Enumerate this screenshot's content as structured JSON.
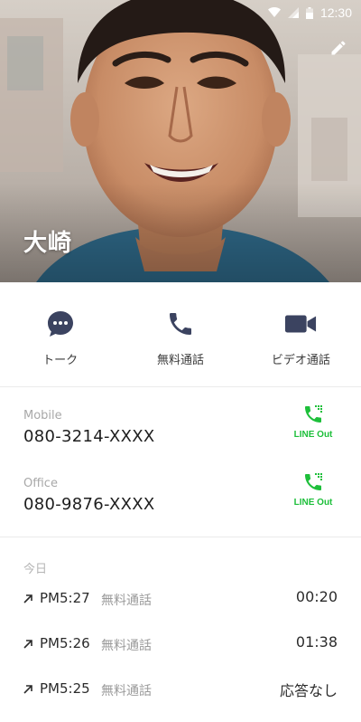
{
  "status_bar": {
    "time": "12:30",
    "icons": [
      "wifi-icon",
      "signal-icon",
      "battery-icon"
    ]
  },
  "header": {
    "name": "大崎",
    "edit_icon": "pencil-icon"
  },
  "actions": [
    {
      "label": "トーク",
      "icon": "chat-bubble-icon"
    },
    {
      "label": "無料通話",
      "icon": "phone-icon"
    },
    {
      "label": "ビデオ通話",
      "icon": "video-camera-icon"
    }
  ],
  "phones": [
    {
      "type": "Mobile",
      "number": "080-3214-XXXX",
      "action_label": "LINE Out"
    },
    {
      "type": "Office",
      "number": "080-9876-XXXX",
      "action_label": "LINE Out"
    }
  ],
  "history": {
    "title": "今日",
    "calls": [
      {
        "time": "PM5:27",
        "type": "無料通話",
        "result": "00:20"
      },
      {
        "time": "PM5:26",
        "type": "無料通話",
        "result": "01:38"
      },
      {
        "time": "PM5:25",
        "type": "無料通話",
        "result": "応答なし"
      }
    ]
  },
  "colors": {
    "accent_icon": "#3b4360",
    "line_green": "#1dbf3a",
    "divider": "#ebebeb"
  }
}
